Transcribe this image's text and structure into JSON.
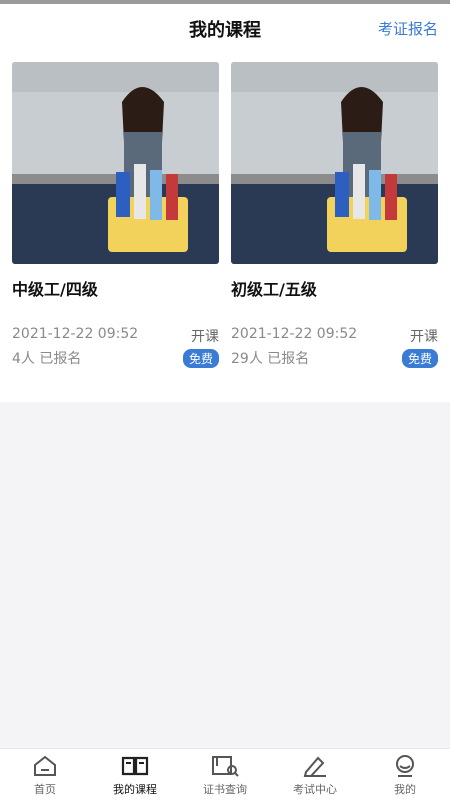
{
  "header": {
    "title": "我的课程",
    "action": "考证报名"
  },
  "courses": [
    {
      "title": "中级工/四级",
      "datetime": "2021-12-22 09:52",
      "status": "开课",
      "enrolled": "4人 已报名",
      "price_badge": "免费"
    },
    {
      "title": "初级工/五级",
      "datetime": "2021-12-22 09:52",
      "status": "开课",
      "enrolled": "29人 已报名",
      "price_badge": "免费"
    }
  ],
  "tabbar": {
    "items": [
      {
        "label": "首页",
        "icon": "home-icon"
      },
      {
        "label": "我的课程",
        "icon": "book-icon",
        "active": true
      },
      {
        "label": "证书查询",
        "icon": "certificate-search-icon"
      },
      {
        "label": "考试中心",
        "icon": "pen-icon"
      },
      {
        "label": "我的",
        "icon": "profile-icon"
      }
    ]
  },
  "colors": {
    "accent": "#3a7bd5",
    "background": "#f4f4f6"
  }
}
